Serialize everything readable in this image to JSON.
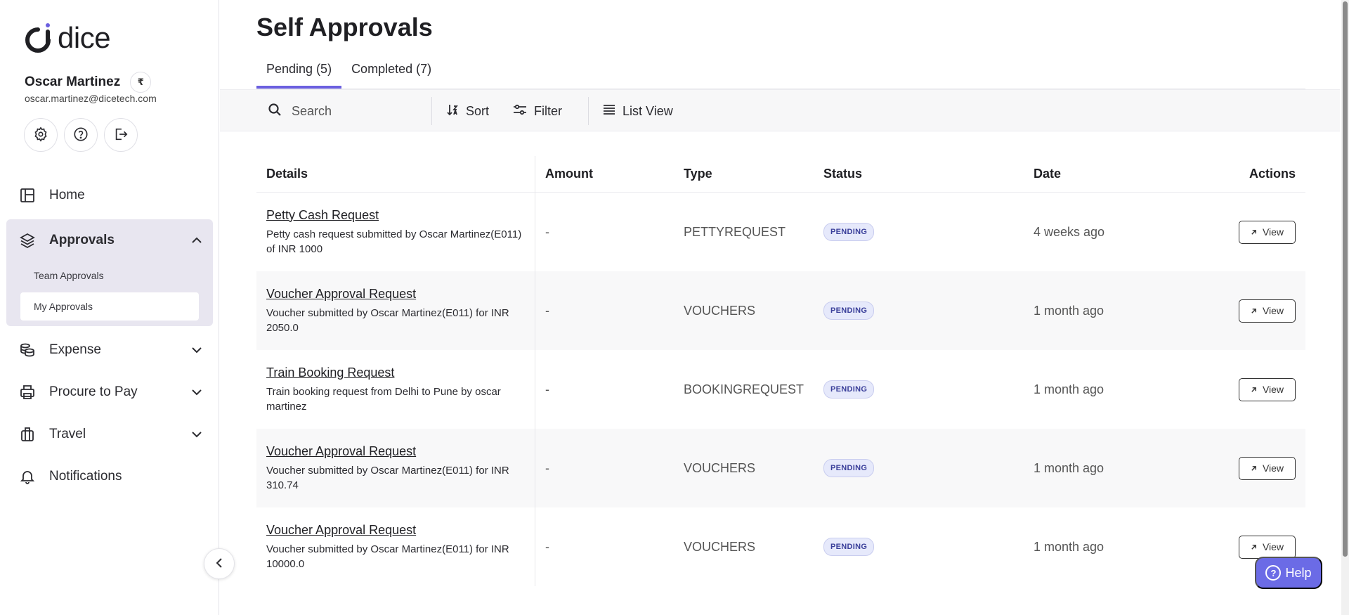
{
  "app": {
    "logo_text": "dice",
    "brand_accent": "#6b5fe0"
  },
  "user": {
    "name": "Oscar Martinez",
    "email": "oscar.martinez@dicetech.com",
    "currency_symbol": "₹"
  },
  "sidebar": {
    "quick_actions": [
      {
        "name": "settings",
        "icon": "gear-icon"
      },
      {
        "name": "help",
        "icon": "question-circle-icon"
      },
      {
        "name": "logout",
        "icon": "logout-icon"
      }
    ],
    "nav": {
      "home": "Home",
      "approvals": "Approvals",
      "team_approvals": "Team Approvals",
      "my_approvals": "My Approvals",
      "expense": "Expense",
      "procure_to_pay": "Procure to Pay",
      "travel": "Travel",
      "notifications": "Notifications"
    }
  },
  "page": {
    "title": "Self Approvals",
    "tabs": [
      {
        "label": "Pending (5)",
        "active": true
      },
      {
        "label": "Completed (7)",
        "active": false
      }
    ]
  },
  "toolbar": {
    "search_placeholder": "Search",
    "sort_label": "Sort",
    "filter_label": "Filter",
    "view_label": "List View"
  },
  "table": {
    "headers": {
      "details": "Details",
      "amount": "Amount",
      "type": "Type",
      "status": "Status",
      "date": "Date",
      "actions": "Actions"
    },
    "rows": [
      {
        "title": "Petty Cash Request",
        "description": "Petty cash request submitted by Oscar Martinez(E011) of INR 1000",
        "amount": "-",
        "type": "PETTYREQUEST",
        "status": "PENDING",
        "date": "4 weeks ago",
        "action": "View"
      },
      {
        "title": "Voucher Approval Request",
        "description": "Voucher submitted by Oscar Martinez(E011) for INR 2050.0",
        "amount": "-",
        "type": "VOUCHERS",
        "status": "PENDING",
        "date": "1 month ago",
        "action": "View"
      },
      {
        "title": "Train Booking Request",
        "description": "Train booking request from Delhi to Pune by oscar martinez",
        "amount": "-",
        "type": "BOOKINGREQUEST",
        "status": "PENDING",
        "date": "1 month ago",
        "action": "View"
      },
      {
        "title": "Voucher Approval Request",
        "description": "Voucher submitted by Oscar Martinez(E011) for INR 310.74",
        "amount": "-",
        "type": "VOUCHERS",
        "status": "PENDING",
        "date": "1 month ago",
        "action": "View"
      },
      {
        "title": "Voucher Approval Request",
        "description": "Voucher submitted by Oscar Martinez(E011) for INR 10000.0",
        "amount": "-",
        "type": "VOUCHERS",
        "status": "PENDING",
        "date": "1 month ago",
        "action": "View"
      }
    ]
  },
  "help_button": {
    "label": "Help"
  }
}
